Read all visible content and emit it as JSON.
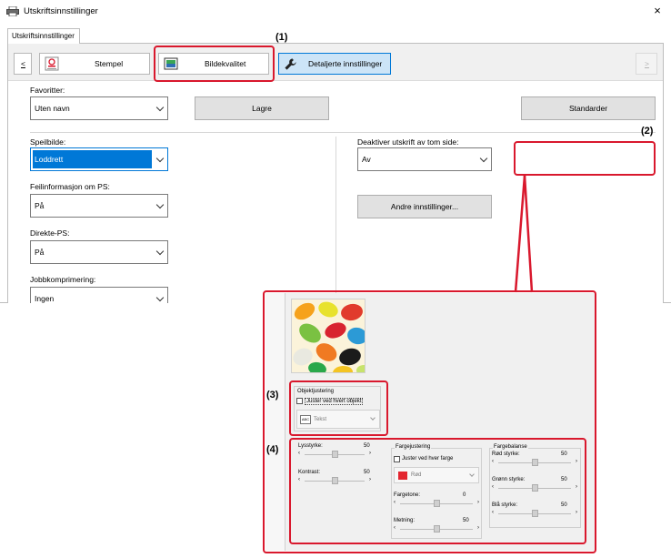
{
  "window": {
    "title": "Utskriftsinnstillinger",
    "close_glyph": "×"
  },
  "tab": {
    "label": "Utskriftsinnstillinger"
  },
  "toolbar": {
    "prev_label": "<",
    "next_label": ">",
    "items": [
      {
        "label": "Stempel"
      },
      {
        "label": "Bildekvalitet"
      },
      {
        "label": "Detaljerte innstillinger"
      }
    ]
  },
  "favorites": {
    "label": "Favoritter:",
    "value": "Uten navn",
    "save_label": "Lagre",
    "defaults_label": "Standarder"
  },
  "left_fields": [
    {
      "label": "Speilbilde:",
      "value": "Loddrett"
    },
    {
      "label": "Feilinformasjon om PS:",
      "value": "På"
    },
    {
      "label": "Direkte-PS:",
      "value": "På"
    },
    {
      "label": "Jobbkomprimering:",
      "value": "Ingen"
    }
  ],
  "blank_page": {
    "label": "Deaktiver utskrift av tom side:",
    "value": "Av"
  },
  "other_settings": {
    "label": "Andre innstillinger..."
  },
  "callouts": {
    "c1": "(1)",
    "c2": "(2)",
    "c3": "(3)",
    "c4": "(4)"
  },
  "detail": {
    "object_adjust": {
      "title": "Objektjustering",
      "checkbox_label": "Juster ved hvert objekt",
      "dropdown_value": "Tekst",
      "dropdown_icon": "ABC"
    },
    "brightness": {
      "label": "Lysstyrke:",
      "value": "50",
      "level": 0.5
    },
    "contrast": {
      "label": "Kontrast:",
      "value": "50",
      "level": 0.5
    },
    "color_adjust": {
      "title": "Fargejustering",
      "checkbox_label": "Juster ved hver farge",
      "dropdown_value": "Rød",
      "swatch_color": "#e3252f",
      "hue": {
        "label": "Fargetone:",
        "value": "0",
        "level": 0.5
      },
      "saturation": {
        "label": "Metning:",
        "value": "50",
        "level": 0.5
      }
    },
    "color_balance": {
      "title": "Fargebalanse",
      "red": {
        "label": "Rød styrke:",
        "value": "50",
        "level": 0.5
      },
      "green": {
        "label": "Grønn styrke:",
        "value": "50",
        "level": 0.5
      },
      "blue": {
        "label": "Blå styrke:",
        "value": "50",
        "level": 0.5
      }
    }
  },
  "colors": {
    "accent": "#0078d7",
    "callout_red": "#d9182d"
  }
}
